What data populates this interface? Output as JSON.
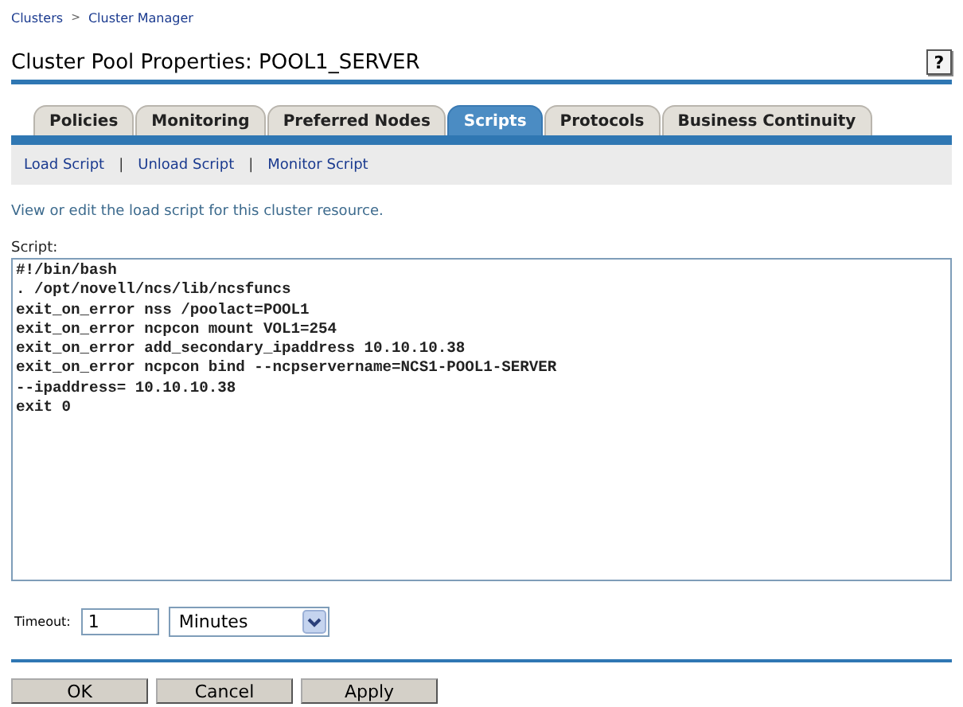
{
  "breadcrumb": [
    "Clusters",
    "Cluster Manager"
  ],
  "breadcrumb_separator": ">",
  "title": "Cluster Pool Properties: POOL1_SERVER",
  "help_button": "?",
  "tabs": [
    {
      "label": "Policies",
      "selected": false
    },
    {
      "label": "Monitoring",
      "selected": false
    },
    {
      "label": "Preferred Nodes",
      "selected": false
    },
    {
      "label": "Scripts",
      "selected": true
    },
    {
      "label": "Protocols",
      "selected": false
    },
    {
      "label": "Business Continuity",
      "selected": false
    }
  ],
  "subnav": {
    "links": [
      "Load Script",
      "Unload Script",
      "Monitor Script"
    ],
    "separator": "|"
  },
  "description": "View or edit the load script for this cluster resource.",
  "script": {
    "label": "Script:",
    "lines": [
      "#!/bin/bash",
      ". /opt/novell/ncs/lib/ncsfuncs",
      "exit_on_error nss /poolact=POOL1",
      "exit_on_error ncpcon mount VOL1=254",
      "exit_on_error add_secondary_ipaddress 10.10.10.38",
      "exit_on_error ncpcon bind --ncpservername=NCS1-POOL1-SERVER",
      "--ipaddress= 10.10.10.38",
      "exit 0"
    ]
  },
  "timeout": {
    "label": "Timeout:",
    "value": "1",
    "unit": "Minutes"
  },
  "buttons": [
    "OK",
    "Cancel",
    "Apply"
  ]
}
